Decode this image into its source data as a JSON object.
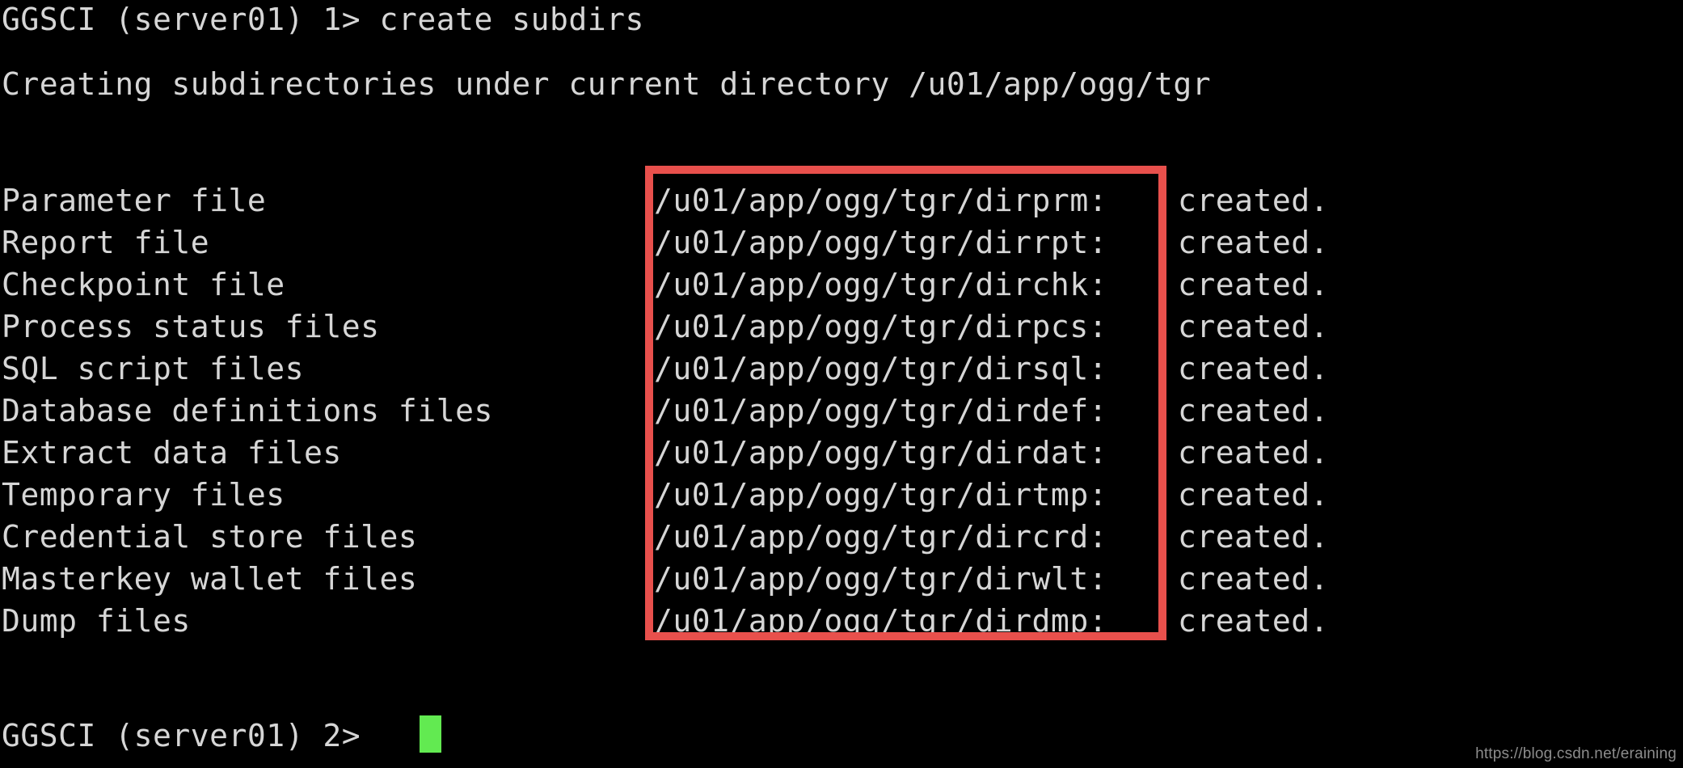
{
  "terminal": {
    "background_color": "#000000",
    "text_color": "#d6d6d6",
    "cursor_color": "#62ea51",
    "highlight_color": "#e8504c",
    "prompt_line_1": "GGSCI (server01) 1> create subdirs",
    "creating_line": "Creating subdirectories under current directory /u01/app/ogg/tgr",
    "prompt_line_2": "GGSCI (server01) 2>",
    "rows": [
      {
        "label": "Parameter file",
        "path": "/u01/app/ogg/tgr/dirprm:",
        "status": "created."
      },
      {
        "label": "Report file",
        "path": "/u01/app/ogg/tgr/dirrpt:",
        "status": "created."
      },
      {
        "label": "Checkpoint file",
        "path": "/u01/app/ogg/tgr/dirchk:",
        "status": "created."
      },
      {
        "label": "Process status files",
        "path": "/u01/app/ogg/tgr/dirpcs:",
        "status": "created."
      },
      {
        "label": "SQL script files",
        "path": "/u01/app/ogg/tgr/dirsql:",
        "status": "created."
      },
      {
        "label": "Database definitions files",
        "path": "/u01/app/ogg/tgr/dirdef:",
        "status": "created."
      },
      {
        "label": "Extract data files",
        "path": "/u01/app/ogg/tgr/dirdat:",
        "status": "created."
      },
      {
        "label": "Temporary files",
        "path": "/u01/app/ogg/tgr/dirtmp:",
        "status": "created."
      },
      {
        "label": "Credential store files",
        "path": "/u01/app/ogg/tgr/dircrd:",
        "status": "created."
      },
      {
        "label": "Masterkey wallet files",
        "path": "/u01/app/ogg/tgr/dirwlt:",
        "status": "created."
      },
      {
        "label": "Dump files",
        "path": "/u01/app/ogg/tgr/dirdmp:",
        "status": "created."
      }
    ]
  },
  "watermark": {
    "text": "https://blog.csdn.net/eraining"
  }
}
